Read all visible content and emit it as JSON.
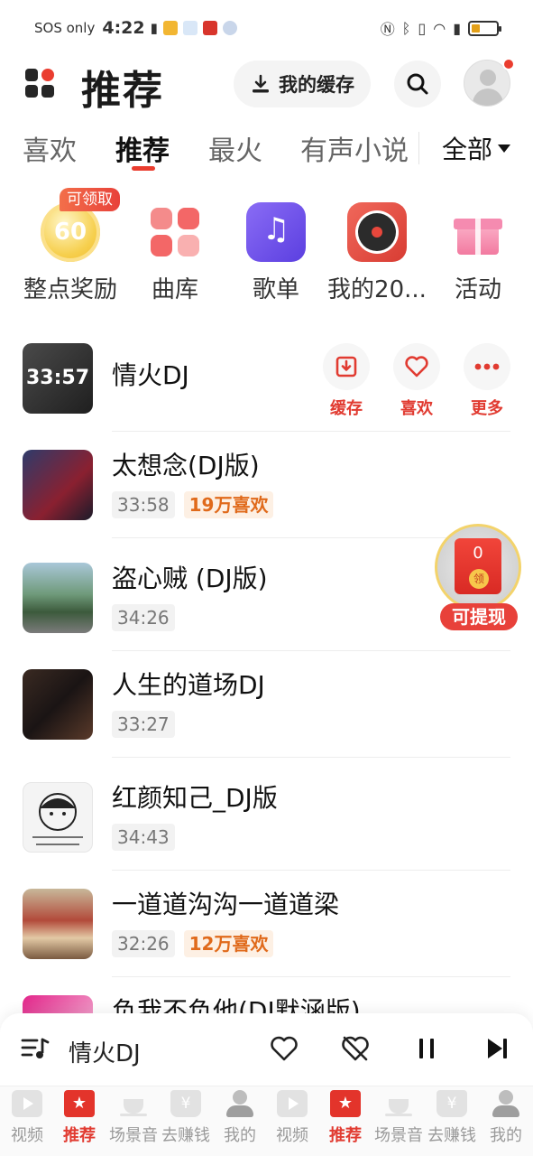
{
  "status_bar": {
    "carrier": "SOS only",
    "time": "4:22"
  },
  "header": {
    "title": "推荐",
    "cache_label": "我的缓存"
  },
  "tabs": {
    "items": [
      "喜欢",
      "推荐",
      "最火",
      "有声小说"
    ],
    "active": "推荐",
    "all_label": "全部"
  },
  "quick_entries": {
    "reward_coin": "60",
    "claim_badge": "可领取",
    "items": [
      {
        "label": "整点奖励",
        "icon": "coin-icon"
      },
      {
        "label": "曲库",
        "icon": "library-icon"
      },
      {
        "label": "歌单",
        "icon": "playlist-icon"
      },
      {
        "label": "我的20...",
        "icon": "record-icon"
      },
      {
        "label": "活动",
        "icon": "gift-icon"
      }
    ]
  },
  "songs": [
    {
      "title": "情火DJ",
      "cover_label": "33:57",
      "duration": "",
      "likes": ""
    },
    {
      "title": "太想念(DJ版)",
      "duration": "33:58",
      "likes": "19万喜欢"
    },
    {
      "title": "盗心贼 (DJ版)",
      "duration": "34:26",
      "likes": ""
    },
    {
      "title": "人生的道场DJ",
      "duration": "33:27",
      "likes": ""
    },
    {
      "title": "红颜知己_DJ版",
      "duration": "34:43",
      "likes": ""
    },
    {
      "title": "一道道沟沟一道道梁",
      "duration": "32:26",
      "likes": "12万喜欢"
    },
    {
      "title": "负我不负他(DJ默涵版)",
      "duration": "",
      "likes": ""
    }
  ],
  "song_actions": {
    "cache": "缓存",
    "like": "喜欢",
    "more": "更多"
  },
  "floating_envelope": {
    "amount": "0",
    "coin_text": "领",
    "label": "可提现"
  },
  "player": {
    "now_playing": "情火DJ"
  },
  "bottom_nav": {
    "items": [
      {
        "label": "视频",
        "icon": "video-icon"
      },
      {
        "label": "推荐",
        "icon": "recommend-icon",
        "active": true
      },
      {
        "label": "场景音",
        "icon": "cup-icon"
      },
      {
        "label": "去赚钱",
        "icon": "money-icon"
      },
      {
        "label": "我的",
        "icon": "profile-icon"
      },
      {
        "label": "视频",
        "icon": "video-icon"
      },
      {
        "label": "推荐",
        "icon": "recommend-icon",
        "active": true
      },
      {
        "label": "场景音",
        "icon": "cup-icon"
      },
      {
        "label": "去赚钱",
        "icon": "money-icon"
      },
      {
        "label": "我的",
        "icon": "profile-icon"
      }
    ]
  },
  "colors": {
    "accent": "#e13b31",
    "likes_text": "#e06a1b",
    "likes_bg": "#fdf0e4"
  }
}
